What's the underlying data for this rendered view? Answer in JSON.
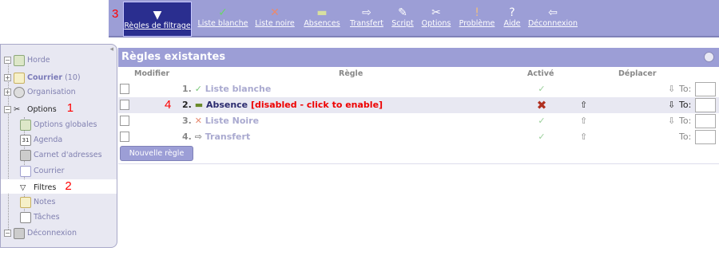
{
  "toolbar": {
    "items": [
      {
        "label": "Règles de filtrage",
        "icon": "filter-icon"
      },
      {
        "label": "Liste blanche",
        "icon": "check-icon"
      },
      {
        "label": "Liste noire",
        "icon": "cross-icon"
      },
      {
        "label": "Absences",
        "icon": "vacation-icon"
      },
      {
        "label": "Transfert",
        "icon": "forward-icon"
      },
      {
        "label": "Script",
        "icon": "script-icon"
      },
      {
        "label": "Options",
        "icon": "tools-icon"
      },
      {
        "label": "Problème",
        "icon": "problem-icon"
      },
      {
        "label": "Aide",
        "icon": "help-icon"
      },
      {
        "label": "Déconnexion",
        "icon": "logout-icon"
      }
    ]
  },
  "annotations": {
    "one": "1",
    "two": "2",
    "three": "3",
    "four": "4"
  },
  "sidebar": {
    "items": [
      {
        "label": "Horde"
      },
      {
        "label": "Courrier",
        "count": "(10)"
      },
      {
        "label": "Organisation"
      },
      {
        "label": "Options"
      },
      {
        "label": "Options globales"
      },
      {
        "label": "Agenda"
      },
      {
        "label": "Carnet d'adresses"
      },
      {
        "label": "Courrier"
      },
      {
        "label": "Filtres"
      },
      {
        "label": "Notes"
      },
      {
        "label": "Tâches"
      },
      {
        "label": "Déconnexion"
      }
    ]
  },
  "main": {
    "title": "Règles existantes",
    "columns": {
      "modify": "Modifier",
      "rule": "Règle",
      "active": "Activé",
      "move": "Déplacer"
    },
    "rules": [
      {
        "num": "1.",
        "name": "Liste blanche",
        "disabled": "",
        "active": true
      },
      {
        "num": "2.",
        "name": "Absence",
        "disabled": "[disabled - click to enable]",
        "active": false
      },
      {
        "num": "3.",
        "name": "Liste Noire",
        "disabled": "",
        "active": true
      },
      {
        "num": "4.",
        "name": "Transfert",
        "disabled": "",
        "active": true
      }
    ],
    "to_label": "To:",
    "new_rule": "Nouvelle règle"
  },
  "colors": {
    "accent": "#9c9ed6",
    "active_tool": "#2a2e8f",
    "annotation": "#ff0000",
    "disabled": "#e00000"
  }
}
